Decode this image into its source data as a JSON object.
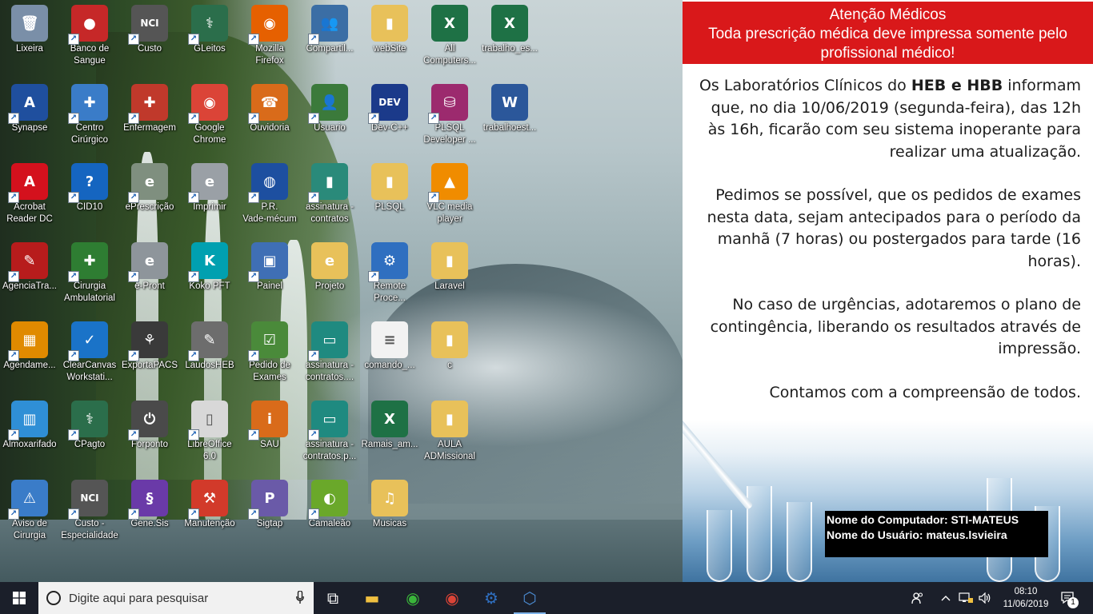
{
  "desktop": {
    "icons": [
      {
        "label": "Lixeira",
        "icon": "recycle-bin-icon",
        "color": "#7a8fa8",
        "glyph": "🗑",
        "col": 0,
        "row": 0,
        "shortcut": false
      },
      {
        "label": "Banco de\nSangue",
        "icon": "blood-drops-icon",
        "color": "#c62828",
        "glyph": "●",
        "col": 1,
        "row": 0,
        "shortcut": true
      },
      {
        "label": "Custo",
        "icon": "nci-custo-icon",
        "color": "#555555",
        "glyph": "NCI",
        "col": 2,
        "row": 0,
        "shortcut": true
      },
      {
        "label": "GLeitos",
        "icon": "gleitos-icon",
        "color": "#2b6e4b",
        "glyph": "⚕",
        "col": 3,
        "row": 0,
        "shortcut": true
      },
      {
        "label": "Mozilla\nFirefox",
        "icon": "firefox-icon",
        "color": "#e66000",
        "glyph": "◉",
        "col": 4,
        "row": 0,
        "shortcut": true
      },
      {
        "label": "Compartil...",
        "icon": "users-share-icon",
        "color": "#3b6ea5",
        "glyph": "👥",
        "col": 5,
        "row": 0,
        "shortcut": true
      },
      {
        "label": "webSite",
        "icon": "folder-icon",
        "color": "#e8c15a",
        "glyph": "▮",
        "col": 6,
        "row": 0,
        "shortcut": false
      },
      {
        "label": "All\nComputers...",
        "icon": "excel-icon",
        "color": "#1e7145",
        "glyph": "X",
        "col": 7,
        "row": 0,
        "shortcut": false
      },
      {
        "label": "trabalho_es...",
        "icon": "excel-icon",
        "color": "#1e7145",
        "glyph": "X",
        "col": 8,
        "row": 0,
        "shortcut": false
      },
      {
        "label": "Synapse",
        "icon": "synapse-icon",
        "color": "#1f4f9e",
        "glyph": "A",
        "col": 0,
        "row": 1,
        "shortcut": true
      },
      {
        "label": "Centro\nCirúrgico",
        "icon": "surgeon-icon",
        "color": "#3a7cc8",
        "glyph": "✚",
        "col": 1,
        "row": 1,
        "shortcut": true
      },
      {
        "label": "Enfermagem",
        "icon": "nurse-icon",
        "color": "#c0392b",
        "glyph": "✚",
        "col": 2,
        "row": 1,
        "shortcut": true
      },
      {
        "label": "Google\nChrome",
        "icon": "chrome-icon",
        "color": "#db4437",
        "glyph": "◉",
        "col": 3,
        "row": 1,
        "shortcut": true
      },
      {
        "label": "Ouvidoria",
        "icon": "support-agent-icon",
        "color": "#d96b1a",
        "glyph": "☎",
        "col": 4,
        "row": 1,
        "shortcut": true
      },
      {
        "label": "Usuario",
        "icon": "user-icon",
        "color": "#3b7a3b",
        "glyph": "👤",
        "col": 5,
        "row": 1,
        "shortcut": true
      },
      {
        "label": "Dev-C++",
        "icon": "devcpp-icon",
        "color": "#1b3a8a",
        "glyph": "DEV",
        "col": 6,
        "row": 1,
        "shortcut": true
      },
      {
        "label": "PLSQL\nDeveloper ...",
        "icon": "database-icon",
        "color": "#9c2a6e",
        "glyph": "⛁",
        "col": 7,
        "row": 1,
        "shortcut": true
      },
      {
        "label": "trabalhoest...",
        "icon": "word-icon",
        "color": "#2b579a",
        "glyph": "W",
        "col": 8,
        "row": 1,
        "shortcut": false
      },
      {
        "label": "Acrobat\nReader DC",
        "icon": "acrobat-icon",
        "color": "#d4111d",
        "glyph": "A",
        "col": 0,
        "row": 2,
        "shortcut": true
      },
      {
        "label": "CID10",
        "icon": "help-icon",
        "color": "#1565c0",
        "glyph": "?",
        "col": 1,
        "row": 2,
        "shortcut": true
      },
      {
        "label": "ePrescrição",
        "icon": "eprescricao-icon",
        "color": "#7f8f7f",
        "glyph": "e",
        "col": 2,
        "row": 2,
        "shortcut": true
      },
      {
        "label": "Imprimir",
        "icon": "print-mouse-icon",
        "color": "#9aa0a6",
        "glyph": "e",
        "col": 3,
        "row": 2,
        "shortcut": true
      },
      {
        "label": "P.R.\nVade-mécum",
        "icon": "globe-book-icon",
        "color": "#1d4fa0",
        "glyph": "◍",
        "col": 4,
        "row": 2,
        "shortcut": true
      },
      {
        "label": "assinatura -\ncontratos",
        "icon": "folder-doc-icon",
        "color": "#2a8a7a",
        "glyph": "▮",
        "col": 5,
        "row": 2,
        "shortcut": true
      },
      {
        "label": "PLSQL",
        "icon": "folder-icon",
        "color": "#e8c15a",
        "glyph": "▮",
        "col": 6,
        "row": 2,
        "shortcut": false
      },
      {
        "label": "VLC media\nplayer",
        "icon": "vlc-icon",
        "color": "#f08c00",
        "glyph": "▲",
        "col": 7,
        "row": 2,
        "shortcut": true
      },
      {
        "label": "AgenciaTra...",
        "icon": "syringe-icon",
        "color": "#b71c1c",
        "glyph": "✎",
        "col": 0,
        "row": 3,
        "shortcut": true
      },
      {
        "label": "Cirurgia\nAmbulatorial",
        "icon": "surgeon-green-icon",
        "color": "#2e7d32",
        "glyph": "✚",
        "col": 1,
        "row": 3,
        "shortcut": true
      },
      {
        "label": "e-Pront",
        "icon": "epront-icon",
        "color": "#8e959b",
        "glyph": "e",
        "col": 2,
        "row": 3,
        "shortcut": true
      },
      {
        "label": "Koko PFT",
        "icon": "koko-pft-icon",
        "color": "#00a0b0",
        "glyph": "K",
        "col": 3,
        "row": 3,
        "shortcut": true
      },
      {
        "label": "Painel",
        "icon": "chat-computer-icon",
        "color": "#3f6fb5",
        "glyph": "▣",
        "col": 4,
        "row": 3,
        "shortcut": true
      },
      {
        "label": "Projeto",
        "icon": "folder-ie-icon",
        "color": "#e8c15a",
        "glyph": "e",
        "col": 5,
        "row": 3,
        "shortcut": false
      },
      {
        "label": "Remote\nProce...",
        "icon": "remote-process-icon",
        "color": "#2f6fc0",
        "glyph": "⚙",
        "col": 6,
        "row": 3,
        "shortcut": true
      },
      {
        "label": "Laravel",
        "icon": "folder-icon",
        "color": "#e8c15a",
        "glyph": "▮",
        "col": 7,
        "row": 3,
        "shortcut": false
      },
      {
        "label": "Agendame...",
        "icon": "scheduler-icon",
        "color": "#e08a00",
        "glyph": "▦",
        "col": 0,
        "row": 4,
        "shortcut": true
      },
      {
        "label": "ClearCanvas\nWorkstati...",
        "icon": "clearcanvas-icon",
        "color": "#1a73c8",
        "glyph": "✓",
        "col": 1,
        "row": 4,
        "shortcut": true
      },
      {
        "label": "ExportaPACS",
        "icon": "xray-lungs-icon",
        "color": "#3a3a3a",
        "glyph": "⚘",
        "col": 2,
        "row": 4,
        "shortcut": true
      },
      {
        "label": "LaudosHEB",
        "icon": "report-pencil-icon",
        "color": "#6d6d6d",
        "glyph": "✎",
        "col": 3,
        "row": 4,
        "shortcut": true
      },
      {
        "label": "Pedido de\nExames",
        "icon": "lab-checklist-icon",
        "color": "#4a8a3a",
        "glyph": "☑",
        "col": 4,
        "row": 4,
        "shortcut": true
      },
      {
        "label": "assinatura -\ncontratos....",
        "icon": "doc-shortcut-icon",
        "color": "#1f8a80",
        "glyph": "▭",
        "col": 5,
        "row": 4,
        "shortcut": true
      },
      {
        "label": "comando_...",
        "icon": "text-file-icon",
        "color": "#f2f2f2",
        "glyph": "≡",
        "col": 6,
        "row": 4,
        "shortcut": false
      },
      {
        "label": "c",
        "icon": "folder-icon",
        "color": "#e8c15a",
        "glyph": "▮",
        "col": 7,
        "row": 4,
        "shortcut": false
      },
      {
        "label": "Almoxarifado",
        "icon": "battery-icon",
        "color": "#2f8fd6",
        "glyph": "▥",
        "col": 0,
        "row": 5,
        "shortcut": true
      },
      {
        "label": "CPagto",
        "icon": "cpagto-icon",
        "color": "#2b6e4b",
        "glyph": "⚕",
        "col": 1,
        "row": 5,
        "shortcut": true
      },
      {
        "label": "Forponto",
        "icon": "power-icon",
        "color": "#4a4a4a",
        "glyph": "⏻",
        "col": 2,
        "row": 5,
        "shortcut": true
      },
      {
        "label": "LibreOffice\n6.0",
        "icon": "libreoffice-icon",
        "color": "#d8d8d8",
        "glyph": "▯",
        "col": 3,
        "row": 5,
        "shortcut": true
      },
      {
        "label": "SAU",
        "icon": "sau-agent-icon",
        "color": "#d96b1a",
        "glyph": "i",
        "col": 4,
        "row": 5,
        "shortcut": true
      },
      {
        "label": "assinatura -\ncontratos.p...",
        "icon": "doc-shortcut-icon",
        "color": "#1f8a80",
        "glyph": "▭",
        "col": 5,
        "row": 5,
        "shortcut": true
      },
      {
        "label": "Ramais_am...",
        "icon": "excel-icon",
        "color": "#1e7145",
        "glyph": "X",
        "col": 6,
        "row": 5,
        "shortcut": false
      },
      {
        "label": "AULA\nADMissional",
        "icon": "folder-icon",
        "color": "#e8c15a",
        "glyph": "▮",
        "col": 7,
        "row": 5,
        "shortcut": false
      },
      {
        "label": "Aviso de\nCirurgia",
        "icon": "surgeon-warning-icon",
        "color": "#3a7cc8",
        "glyph": "⚠",
        "col": 0,
        "row": 6,
        "shortcut": true
      },
      {
        "label": "Custo -\nEspecialidade",
        "icon": "nci-custo-icon",
        "color": "#555555",
        "glyph": "NCI",
        "col": 1,
        "row": 6,
        "shortcut": true
      },
      {
        "label": "Gene.Sis",
        "icon": "dna-icon",
        "color": "#6a3aa8",
        "glyph": "§",
        "col": 2,
        "row": 6,
        "shortcut": true
      },
      {
        "label": "Manutenção",
        "icon": "toolbox-icon",
        "color": "#d23a2a",
        "glyph": "⚒",
        "col": 3,
        "row": 6,
        "shortcut": true
      },
      {
        "label": "Sigtap",
        "icon": "sigtap-icon",
        "color": "#6a5aa8",
        "glyph": "P",
        "col": 4,
        "row": 6,
        "shortcut": true
      },
      {
        "label": "Camaleão",
        "icon": "chameleon-icon",
        "color": "#6aa82a",
        "glyph": "◐",
        "col": 5,
        "row": 6,
        "shortcut": true
      },
      {
        "label": "Musicas",
        "icon": "folder-music-icon",
        "color": "#e8c15a",
        "glyph": "♫",
        "col": 6,
        "row": 6,
        "shortcut": false
      }
    ]
  },
  "notice": {
    "header_line1": "Atenção Médicos",
    "header_line2": "Toda prescrição médica deve impressa somente pelo",
    "header_line3": "profissional médico!",
    "p1_a": "Os Laboratórios Clínicos do ",
    "p1_b": "HEB e HBB",
    "p1_c": " informam que, no dia 10/06/2019 (segunda-feira), das 12h às 16h, ficarão com seu sistema inoperante para realizar uma atualização.",
    "p2": "Pedimos se possível, que os pedidos de exames nesta data, sejam antecipados para o período da manhã (7 horas) ou postergados para tarde (16 horas).",
    "p3": "No caso de urgências, adotaremos o plano de contingência, liberando os resultados através de impressão.",
    "p4": "Contamos com a compreensão de todos.",
    "computer_line": "Nome do Computador:  STI-MATEUS",
    "user_line": "Nome do Usuário:  mateus.lsvieira"
  },
  "taskbar": {
    "search_placeholder": "Digite aqui para pesquisar",
    "apps": [
      {
        "name": "task-view-icon",
        "glyph": "⧉",
        "color": "#ffffff"
      },
      {
        "name": "file-explorer-icon",
        "glyph": "▬",
        "color": "#f0c040"
      },
      {
        "name": "eye-app-icon",
        "glyph": "◉",
        "color": "#3ab53a"
      },
      {
        "name": "chrome-taskbar-icon",
        "glyph": "◉",
        "color": "#db4437"
      },
      {
        "name": "remote-process-taskbar-icon",
        "glyph": "⚙",
        "color": "#2f6fc0"
      },
      {
        "name": "network-app-icon",
        "glyph": "⬡",
        "color": "#4a8ad0"
      }
    ],
    "time": "08:10",
    "date": "11/06/2019",
    "notification_count": "1"
  },
  "colors": {
    "notice_header": "#d9181a",
    "taskbar": "#1b1f2a"
  }
}
